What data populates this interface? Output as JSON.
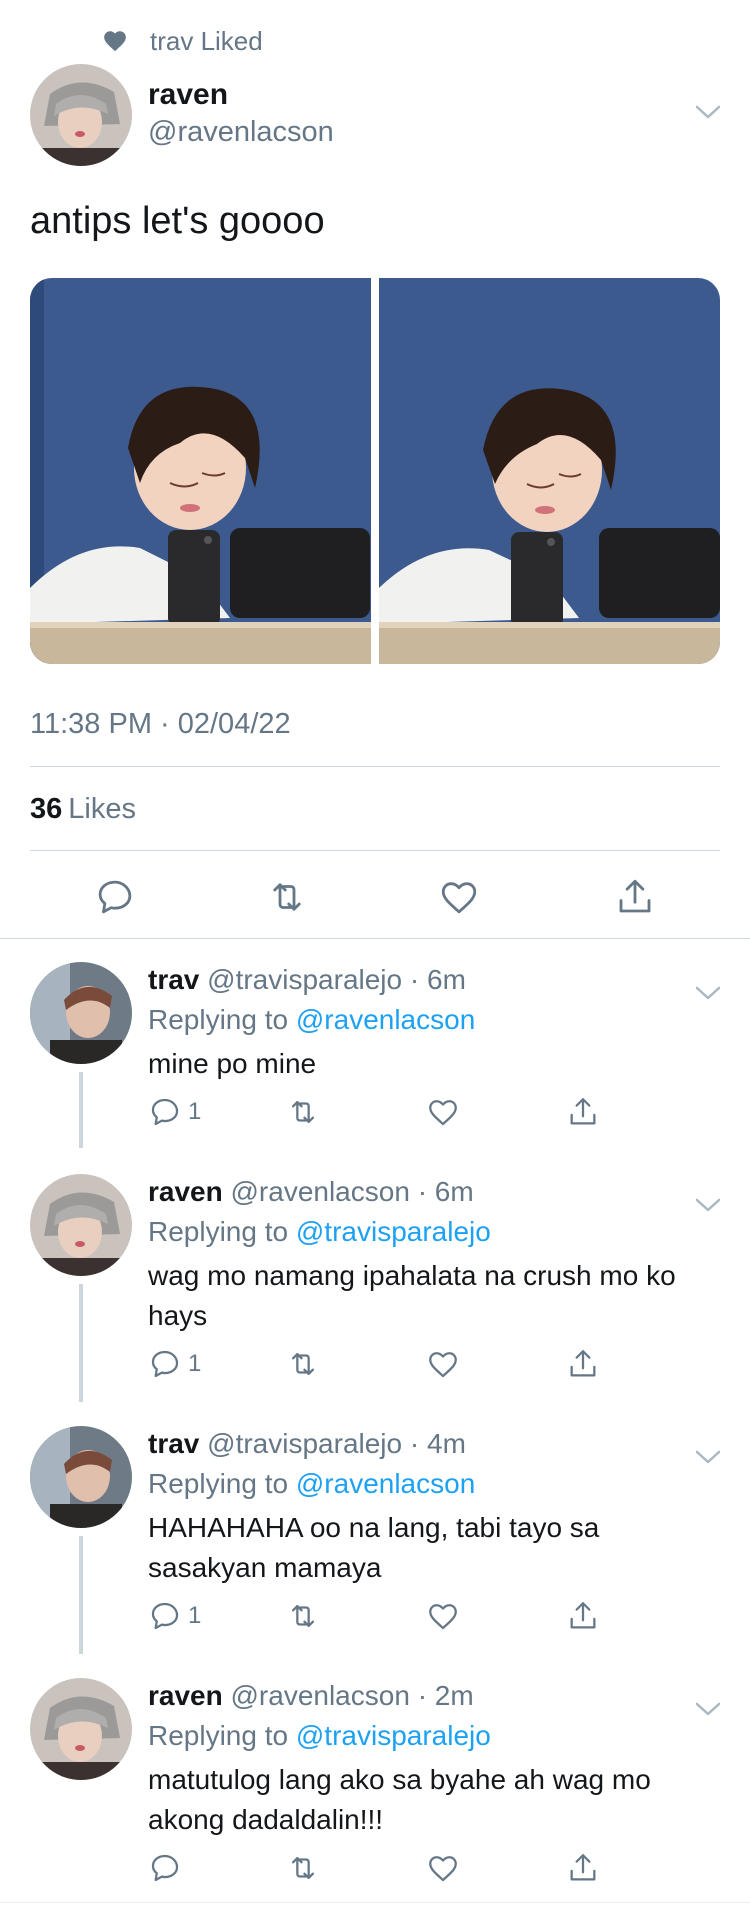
{
  "social_context": {
    "text": "trav Liked",
    "icon": "heart-icon"
  },
  "main_tweet": {
    "author_name": "raven",
    "author_handle": "@ravenlacson",
    "text": "antips let's goooo",
    "timestamp": "11:38 PM · 02/04/22",
    "likes_count": "36",
    "likes_label": "Likes",
    "actions": [
      "reply-icon",
      "retweet-icon",
      "like-icon",
      "share-icon"
    ]
  },
  "replies": [
    {
      "name": "trav",
      "handle": "@travisparalejo",
      "time": "· 6m",
      "replying_prefix": "Replying to",
      "replying_to": "@ravenlacson",
      "text": "mine po mine",
      "reply_count": "1"
    },
    {
      "name": "raven",
      "handle": "@ravenlacson",
      "time": "· 6m",
      "replying_prefix": "Replying to",
      "replying_to": "@travisparalejo",
      "text": "wag mo namang ipahalata na crush mo ko hays",
      "reply_count": "1"
    },
    {
      "name": "trav",
      "handle": "@travisparalejo",
      "time": "· 4m",
      "replying_prefix": "Replying to",
      "replying_to": "@ravenlacson",
      "text": "HAHAHAHA oo na lang, tabi tayo sa sasakyan mamaya",
      "reply_count": "1"
    },
    {
      "name": "raven",
      "handle": "@ravenlacson",
      "time": "· 2m",
      "replying_prefix": "Replying to",
      "replying_to": "@travisparalejo",
      "text": "matutulog lang ako sa byahe ah wag mo akong dadaldalin!!!",
      "reply_count": ""
    }
  ],
  "colors": {
    "accent": "#1da1f2",
    "secondary_text": "#657786",
    "primary_text": "#14171a",
    "divider": "#ccd6dd"
  }
}
